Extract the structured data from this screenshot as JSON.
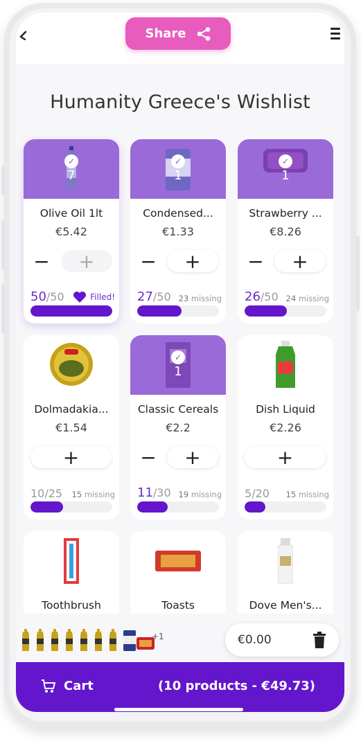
{
  "header": {
    "share_label": "Share",
    "back_icon": "back-arrow-icon",
    "menu_icon": "hamburger-menu-icon",
    "share_icon": "share-icon"
  },
  "page_title": "Humanity Greece's Wishlist",
  "colors": {
    "accent": "#6316cc",
    "selected_card": "#9a6ad8",
    "share": "#e85cbd"
  },
  "products": [
    {
      "name": "Olive Oil 1lt",
      "price": "€5.42",
      "in_cart": "7",
      "selected": true,
      "received": "50",
      "needed": "/50",
      "status": "Filled!",
      "missing": "",
      "progress": 1.0,
      "controls": "minus-plus-disabled"
    },
    {
      "name": "Condensed...",
      "price": "€1.33",
      "in_cart": "1",
      "selected": true,
      "received": "27",
      "needed": "/50",
      "missing_num": "23",
      "missing": " missing",
      "progress": 0.54,
      "controls": "minus-plus"
    },
    {
      "name": "Strawberry ...",
      "price": "€8.26",
      "in_cart": "1",
      "selected": true,
      "received": "26",
      "needed": "/50",
      "missing_num": "24",
      "missing": " missing",
      "progress": 0.52,
      "controls": "minus-plus"
    },
    {
      "name": "Dolmadakia...",
      "price": "€1.54",
      "in_cart": "",
      "selected": false,
      "received": "10",
      "needed": "/25",
      "missing_num": "15",
      "missing": " missing",
      "progress": 0.4,
      "controls": "plus"
    },
    {
      "name": "Classic Cereals",
      "price": "€2.2",
      "in_cart": "1",
      "selected": true,
      "received": "11",
      "needed": "/30",
      "missing_num": "19",
      "missing": " missing",
      "progress": 0.37,
      "controls": "minus-plus"
    },
    {
      "name": "Dish Liquid",
      "price": "€2.26",
      "in_cart": "",
      "selected": false,
      "received": "5",
      "needed": "/20",
      "missing_num": "15",
      "missing": " missing",
      "progress": 0.25,
      "controls": "plus"
    },
    {
      "name": "Toothbrush",
      "price": "",
      "in_cart": "",
      "selected": false
    },
    {
      "name": "Toasts",
      "price": "",
      "in_cart": "",
      "selected": false
    },
    {
      "name": "Dove Men's...",
      "price": "",
      "in_cart": "",
      "selected": false
    }
  ],
  "tray": {
    "more_label": "+1",
    "total": "€0.00",
    "trash_icon": "trash-icon"
  },
  "cart": {
    "label": "Cart",
    "summary": "(10 products - €49.73)",
    "icon": "cart-icon"
  }
}
